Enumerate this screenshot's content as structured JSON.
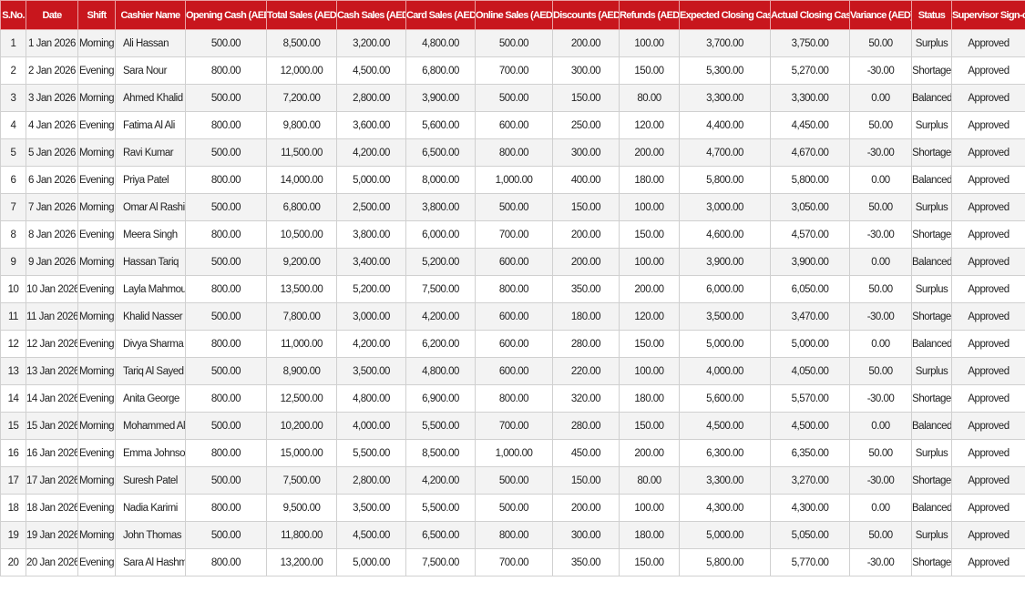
{
  "headers": [
    "S.No.",
    "Date",
    "Shift",
    "Cashier Name",
    "Opening Cash (AED)",
    "Total Sales (AED)",
    "Cash Sales (AED)",
    "Card Sales (AED)",
    "Online Sales (AED)",
    "Discounts (AED)",
    "Refunds (AED)",
    "Expected Closing Cash",
    "Actual Closing Cash",
    "Variance (AED)",
    "Status",
    "Supervisor Sign-off"
  ],
  "rows": [
    [
      "1",
      "1 Jan 2026",
      "Morning",
      "Ali Hassan",
      "500.00",
      "8,500.00",
      "3,200.00",
      "4,800.00",
      "500.00",
      "200.00",
      "100.00",
      "3,700.00",
      "3,750.00",
      "50.00",
      "Surplus",
      "Approved"
    ],
    [
      "2",
      "2 Jan 2026",
      "Evening",
      "Sara Nour",
      "800.00",
      "12,000.00",
      "4,500.00",
      "6,800.00",
      "700.00",
      "300.00",
      "150.00",
      "5,300.00",
      "5,270.00",
      "-30.00",
      "Shortage",
      "Approved"
    ],
    [
      "3",
      "3 Jan 2026",
      "Morning",
      "Ahmed Khalid",
      "500.00",
      "7,200.00",
      "2,800.00",
      "3,900.00",
      "500.00",
      "150.00",
      "80.00",
      "3,300.00",
      "3,300.00",
      "0.00",
      "Balanced",
      "Approved"
    ],
    [
      "4",
      "4 Jan 2026",
      "Evening",
      "Fatima Al Ali",
      "800.00",
      "9,800.00",
      "3,600.00",
      "5,600.00",
      "600.00",
      "250.00",
      "120.00",
      "4,400.00",
      "4,450.00",
      "50.00",
      "Surplus",
      "Approved"
    ],
    [
      "5",
      "5 Jan 2026",
      "Morning",
      "Ravi Kumar",
      "500.00",
      "11,500.00",
      "4,200.00",
      "6,500.00",
      "800.00",
      "300.00",
      "200.00",
      "4,700.00",
      "4,670.00",
      "-30.00",
      "Shortage",
      "Approved"
    ],
    [
      "6",
      "6 Jan 2026",
      "Evening",
      "Priya Patel",
      "800.00",
      "14,000.00",
      "5,000.00",
      "8,000.00",
      "1,000.00",
      "400.00",
      "180.00",
      "5,800.00",
      "5,800.00",
      "0.00",
      "Balanced",
      "Approved"
    ],
    [
      "7",
      "7 Jan 2026",
      "Morning",
      "Omar Al Rashid",
      "500.00",
      "6,800.00",
      "2,500.00",
      "3,800.00",
      "500.00",
      "150.00",
      "100.00",
      "3,000.00",
      "3,050.00",
      "50.00",
      "Surplus",
      "Approved"
    ],
    [
      "8",
      "8 Jan 2026",
      "Evening",
      "Meera Singh",
      "800.00",
      "10,500.00",
      "3,800.00",
      "6,000.00",
      "700.00",
      "200.00",
      "150.00",
      "4,600.00",
      "4,570.00",
      "-30.00",
      "Shortage",
      "Approved"
    ],
    [
      "9",
      "9 Jan 2026",
      "Morning",
      "Hassan Tariq",
      "500.00",
      "9,200.00",
      "3,400.00",
      "5,200.00",
      "600.00",
      "200.00",
      "100.00",
      "3,900.00",
      "3,900.00",
      "0.00",
      "Balanced",
      "Approved"
    ],
    [
      "10",
      "10 Jan 2026",
      "Evening",
      "Layla Mahmoud",
      "800.00",
      "13,500.00",
      "5,200.00",
      "7,500.00",
      "800.00",
      "350.00",
      "200.00",
      "6,000.00",
      "6,050.00",
      "50.00",
      "Surplus",
      "Approved"
    ],
    [
      "11",
      "11 Jan 2026",
      "Morning",
      "Khalid Nasser",
      "500.00",
      "7,800.00",
      "3,000.00",
      "4,200.00",
      "600.00",
      "180.00",
      "120.00",
      "3,500.00",
      "3,470.00",
      "-30.00",
      "Shortage",
      "Approved"
    ],
    [
      "12",
      "12 Jan 2026",
      "Evening",
      "Divya Sharma",
      "800.00",
      "11,000.00",
      "4,200.00",
      "6,200.00",
      "600.00",
      "280.00",
      "150.00",
      "5,000.00",
      "5,000.00",
      "0.00",
      "Balanced",
      "Approved"
    ],
    [
      "13",
      "13 Jan 2026",
      "Morning",
      "Tariq Al Sayed",
      "500.00",
      "8,900.00",
      "3,500.00",
      "4,800.00",
      "600.00",
      "220.00",
      "100.00",
      "4,000.00",
      "4,050.00",
      "50.00",
      "Surplus",
      "Approved"
    ],
    [
      "14",
      "14 Jan 2026",
      "Evening",
      "Anita George",
      "800.00",
      "12,500.00",
      "4,800.00",
      "6,900.00",
      "800.00",
      "320.00",
      "180.00",
      "5,600.00",
      "5,570.00",
      "-30.00",
      "Shortage",
      "Approved"
    ],
    [
      "15",
      "15 Jan 2026",
      "Morning",
      "Mohammed Ali",
      "500.00",
      "10,200.00",
      "4,000.00",
      "5,500.00",
      "700.00",
      "280.00",
      "150.00",
      "4,500.00",
      "4,500.00",
      "0.00",
      "Balanced",
      "Approved"
    ],
    [
      "16",
      "16 Jan 2026",
      "Evening",
      "Emma Johnson",
      "800.00",
      "15,000.00",
      "5,500.00",
      "8,500.00",
      "1,000.00",
      "450.00",
      "200.00",
      "6,300.00",
      "6,350.00",
      "50.00",
      "Surplus",
      "Approved"
    ],
    [
      "17",
      "17 Jan 2026",
      "Morning",
      "Suresh Patel",
      "500.00",
      "7,500.00",
      "2,800.00",
      "4,200.00",
      "500.00",
      "150.00",
      "80.00",
      "3,300.00",
      "3,270.00",
      "-30.00",
      "Shortage",
      "Approved"
    ],
    [
      "18",
      "18 Jan 2026",
      "Evening",
      "Nadia Karimi",
      "800.00",
      "9,500.00",
      "3,500.00",
      "5,500.00",
      "500.00",
      "200.00",
      "100.00",
      "4,300.00",
      "4,300.00",
      "0.00",
      "Balanced",
      "Approved"
    ],
    [
      "19",
      "19 Jan 2026",
      "Morning",
      "John Thomas",
      "500.00",
      "11,800.00",
      "4,500.00",
      "6,500.00",
      "800.00",
      "300.00",
      "180.00",
      "5,000.00",
      "5,050.00",
      "50.00",
      "Surplus",
      "Approved"
    ],
    [
      "20",
      "20 Jan 2026",
      "Evening",
      "Sara Al Hashmi",
      "800.00",
      "13,200.00",
      "5,000.00",
      "7,500.00",
      "700.00",
      "350.00",
      "150.00",
      "5,800.00",
      "5,770.00",
      "-30.00",
      "Shortage",
      "Approved"
    ]
  ],
  "colors": {
    "header_bg": "#c8161d",
    "header_text": "#ffffff",
    "stripe": "#f3f3f3"
  }
}
